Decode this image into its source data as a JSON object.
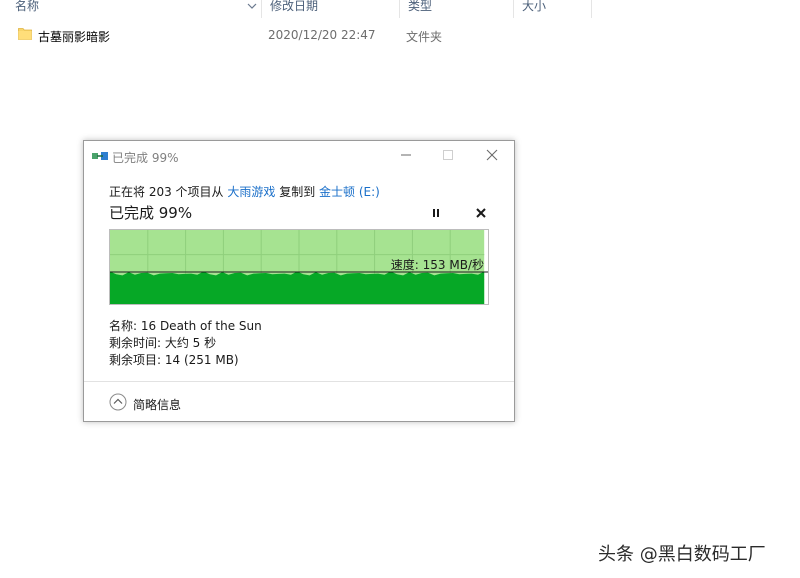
{
  "explorer": {
    "columns": {
      "name": "名称",
      "date_modified": "修改日期",
      "type": "类型",
      "size": "大小"
    },
    "files": [
      {
        "name": "古墓丽影暗影",
        "date": "2020/12/20 22:47",
        "type": "文件夹",
        "icon": "folder-icon"
      }
    ]
  },
  "dialog": {
    "title": "已完成 99%",
    "description": {
      "prefix": "正在将 203 个项目从 ",
      "source": "大雨游戏",
      "middle": " 复制到 ",
      "destination": "金士顿 (E:)"
    },
    "status": "已完成 99%",
    "speed": "速度: 153 MB/秒",
    "progress_percent": 99,
    "info": {
      "name": "名称: 16 Death of the Sun",
      "time_remaining": "剩余时间: 大约 5 秒",
      "items_remaining": "剩余项目: 14 (251 MB)"
    },
    "details_label": "简略信息"
  },
  "colors": {
    "graph_fill": "#06a826",
    "graph_background": "#a6e391",
    "graph_grid": "#8fcf7c",
    "link": "#1a6fc9"
  },
  "watermark": "头条 @黑白数码工厂"
}
